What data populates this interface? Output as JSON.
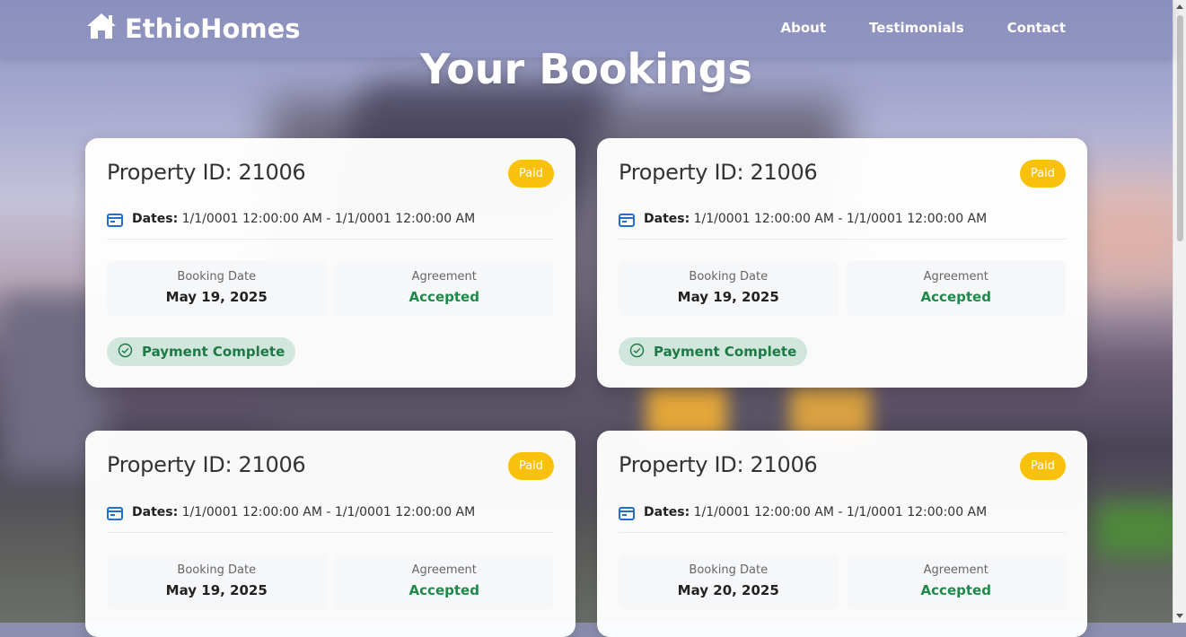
{
  "brand": {
    "name": "EthioHomes",
    "icon": "home-icon"
  },
  "nav": {
    "items": [
      "About",
      "Testimonials",
      "Contact"
    ]
  },
  "page": {
    "title": "Your Bookings"
  },
  "labels": {
    "dates": "Dates:",
    "booking_date": "Booking Date",
    "agreement": "Agreement",
    "payment_complete": "Payment Complete"
  },
  "colors": {
    "badge": "#f9c10b",
    "accepted": "#1d8a4a",
    "payment_pill_bg": "#d1e7dd",
    "calendar_icon": "#1f6fd1"
  },
  "bookings": [
    {
      "property": "Property ID: 21006",
      "status": "Paid",
      "dates": "1/1/0001 12:00:00 AM - 1/1/0001 12:00:00 AM",
      "booking_date": "May 19, 2025",
      "agreement": "Accepted",
      "payment": "Payment Complete"
    },
    {
      "property": "Property ID: 21006",
      "status": "Paid",
      "dates": "1/1/0001 12:00:00 AM - 1/1/0001 12:00:00 AM",
      "booking_date": "May 19, 2025",
      "agreement": "Accepted",
      "payment": "Payment Complete"
    },
    {
      "property": "Property ID: 21006",
      "status": "Paid",
      "dates": "1/1/0001 12:00:00 AM - 1/1/0001 12:00:00 AM",
      "booking_date": "May 19, 2025",
      "agreement": "Accepted"
    },
    {
      "property": "Property ID: 21006",
      "status": "Paid",
      "dates": "1/1/0001 12:00:00 AM - 1/1/0001 12:00:00 AM",
      "booking_date": "May 20, 2025",
      "agreement": "Accepted"
    }
  ]
}
